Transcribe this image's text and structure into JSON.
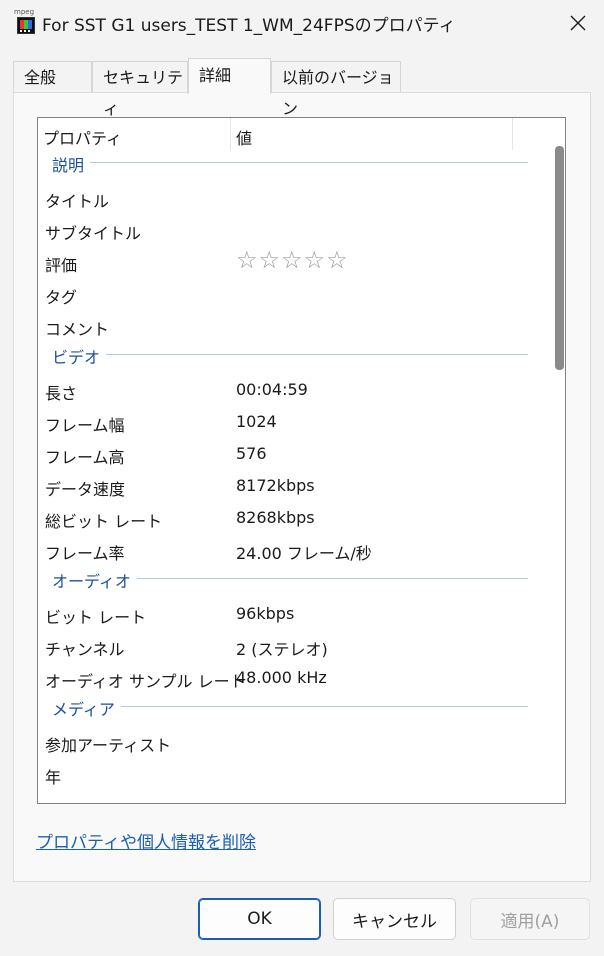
{
  "window": {
    "title": "For SST G1 users_TEST 1_WM_24FPSのプロパティ",
    "icon_label": "mpeg"
  },
  "tabs": [
    {
      "label": "全般",
      "active": false
    },
    {
      "label": "セキュリティ",
      "active": false
    },
    {
      "label": "詳細",
      "active": true
    },
    {
      "label": "以前のバージョン",
      "active": false
    }
  ],
  "list": {
    "col_property": "プロパティ",
    "col_value": "値",
    "groups": [
      {
        "label": "説明"
      },
      {
        "label": "ビデオ"
      },
      {
        "label": "オーディオ"
      },
      {
        "label": "メディア"
      }
    ],
    "rows": [
      {
        "p": "タイトル",
        "v": ""
      },
      {
        "p": "サブタイトル",
        "v": ""
      },
      {
        "p": "評価",
        "v": "",
        "stars": "☆☆☆☆☆",
        "rating": 0
      },
      {
        "p": "タグ",
        "v": ""
      },
      {
        "p": "コメント",
        "v": ""
      },
      {
        "p": "長さ",
        "v": "00:04:59"
      },
      {
        "p": "フレーム幅",
        "v": "1024"
      },
      {
        "p": "フレーム高",
        "v": "576"
      },
      {
        "p": "データ速度",
        "v": "8172kbps"
      },
      {
        "p": "総ビット レート",
        "v": "8268kbps"
      },
      {
        "p": "フレーム率",
        "v": "24.00 フレーム/秒"
      },
      {
        "p": "ビット レート",
        "v": "96kbps"
      },
      {
        "p": "チャンネル",
        "v": "2 (ステレオ)"
      },
      {
        "p": "オーディオ サンプル レート",
        "v": "48.000 kHz"
      },
      {
        "p": "参加アーティスト",
        "v": ""
      },
      {
        "p": "年",
        "v": ""
      }
    ]
  },
  "remove_link": "プロパティや個人情報を削除",
  "buttons": {
    "ok": "OK",
    "cancel": "キャンセル",
    "apply": "適用(A)"
  },
  "colors": {
    "accent": "#1a5fb4",
    "group_label": "#1e4fa0"
  }
}
